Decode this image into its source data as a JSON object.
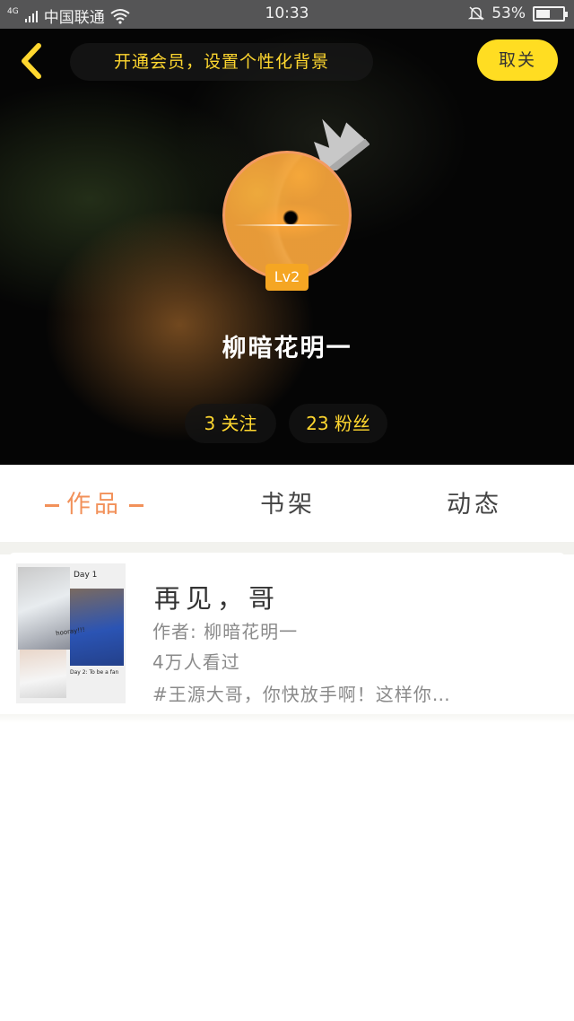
{
  "status_bar": {
    "network_type": "4G",
    "carrier": "中国联通",
    "time": "10:33",
    "battery": "53%",
    "battery_level": 0.53
  },
  "header": {
    "vip_banner": "开通会员，设置个性化背景",
    "unfollow_label": "取关",
    "username": "柳暗花明一",
    "level": "Lv2",
    "following": "3 关注",
    "fans": "23 粉丝"
  },
  "tabs": [
    {
      "label": "作品",
      "active": true
    },
    {
      "label": "书架",
      "active": false
    },
    {
      "label": "动态",
      "active": false
    }
  ],
  "works": [
    {
      "title": "再见，哥",
      "author": "作者: 柳暗花明一",
      "views": "4万人看过",
      "description": "#王源大哥，你快放手啊！这样你…",
      "cover_text": [
        "Day 1",
        "Day 2: To be a fan",
        "hooray!!!"
      ]
    }
  ],
  "colors": {
    "accent_yellow": "#ffdd22",
    "banner_text": "#ffd72f",
    "active_tab": "#f2915a",
    "level_badge": "#f5a623",
    "avatar_ring": "#f39a62",
    "status_bar": "#555556"
  },
  "icons": {
    "back": "chevron-left-icon",
    "crown": "crown-icon",
    "signal": "signal-icon",
    "wifi": "wifi-icon",
    "mute": "bell-off-icon",
    "battery": "battery-icon"
  }
}
